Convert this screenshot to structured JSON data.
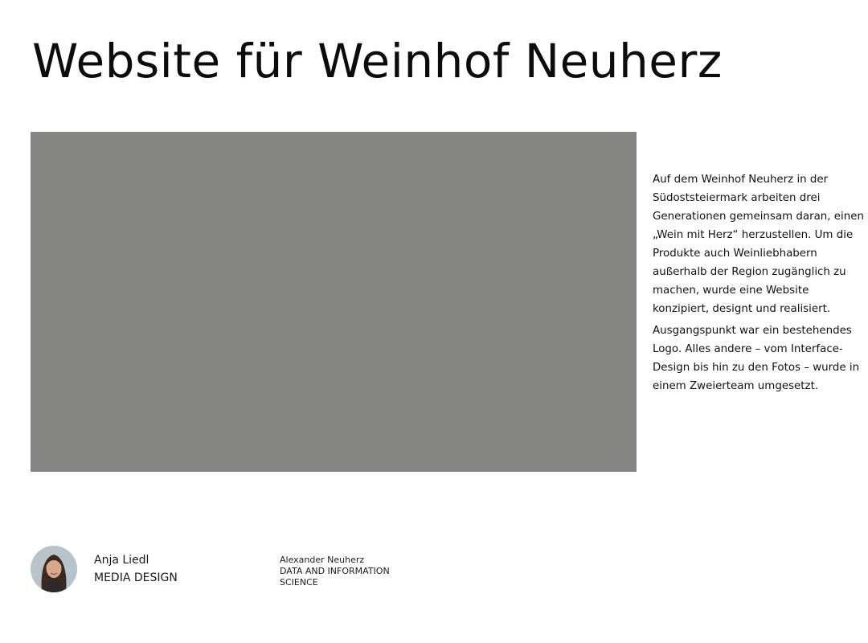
{
  "header": {
    "title": "Website für Weinhof Neuherz"
  },
  "hero": {
    "image_color": "#858583"
  },
  "description": {
    "paragraphs": [
      "Auf dem Weinhof Neuherz in der Südoststeiermark arbeiten drei Generationen gemeinsam daran, einen „Wein mit Herz“ herzustellen. Um die Produkte auch Weinliebhabern außerhalb der Region zugänglich zu machen, wurde eine Website konzipiert, designt und realisiert.",
      "Ausgangspunkt war ein bestehendes Logo. Alles andere – vom Interface-Design bis hin zu den Fotos – wurde in einem Zweierteam umgesetzt."
    ]
  },
  "author": {
    "name": "Anja Liedl",
    "department": "MEDIA DESIGN",
    "avatar_icon": "person-photo"
  },
  "coauthor": {
    "name": "Alexander Neuherz",
    "department_line1": "DATA AND INFORMATION",
    "department_line2": "SCIENCE"
  }
}
